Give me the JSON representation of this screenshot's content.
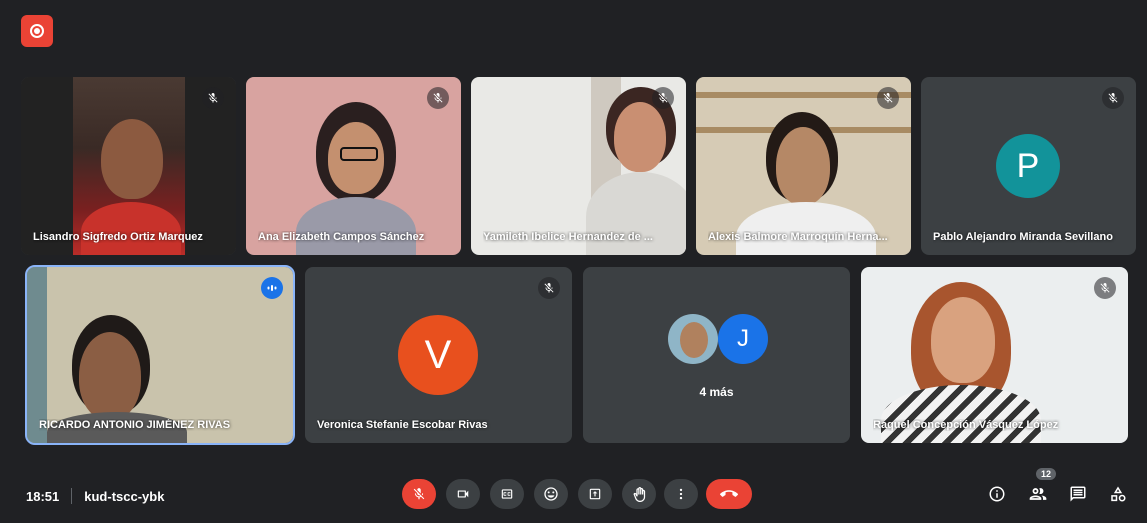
{
  "participants": [
    {
      "name": "Lisandro Sigfredo Ortiz Marquez"
    },
    {
      "name": "Ana Elizabeth Campos Sánchez"
    },
    {
      "name": "Yamileth Ibelice Hernandez de ..."
    },
    {
      "name": "Alexis Balmore Marroquín Herna..."
    },
    {
      "name": "Pablo Alejandro Miranda Sevillano",
      "initial": "P"
    },
    {
      "name": "RICARDO ANTONIO JIMÉNEZ RIVAS"
    },
    {
      "name": "Veronica Stefanie Escobar Rivas",
      "initial": "V"
    },
    {
      "more_label": "4 más",
      "initial": "J"
    },
    {
      "name": "Raquel Concepción Vásquez López"
    }
  ],
  "meeting": {
    "time": "18:51",
    "code": "kud-tscc-ybk"
  },
  "people_count": "12",
  "colors": {
    "background": "#202124",
    "tile": "#3c4043",
    "red": "#ea4335",
    "teal": "#12939a",
    "orange": "#e8501e",
    "blue": "#1a73e8"
  },
  "icons": [
    "record-icon",
    "mic-off-icon",
    "camera-icon",
    "captions-icon",
    "emoji-icon",
    "present-icon",
    "raise-hand-icon",
    "more-options-icon",
    "end-call-icon",
    "info-icon",
    "people-icon",
    "chat-icon",
    "activities-icon"
  ]
}
